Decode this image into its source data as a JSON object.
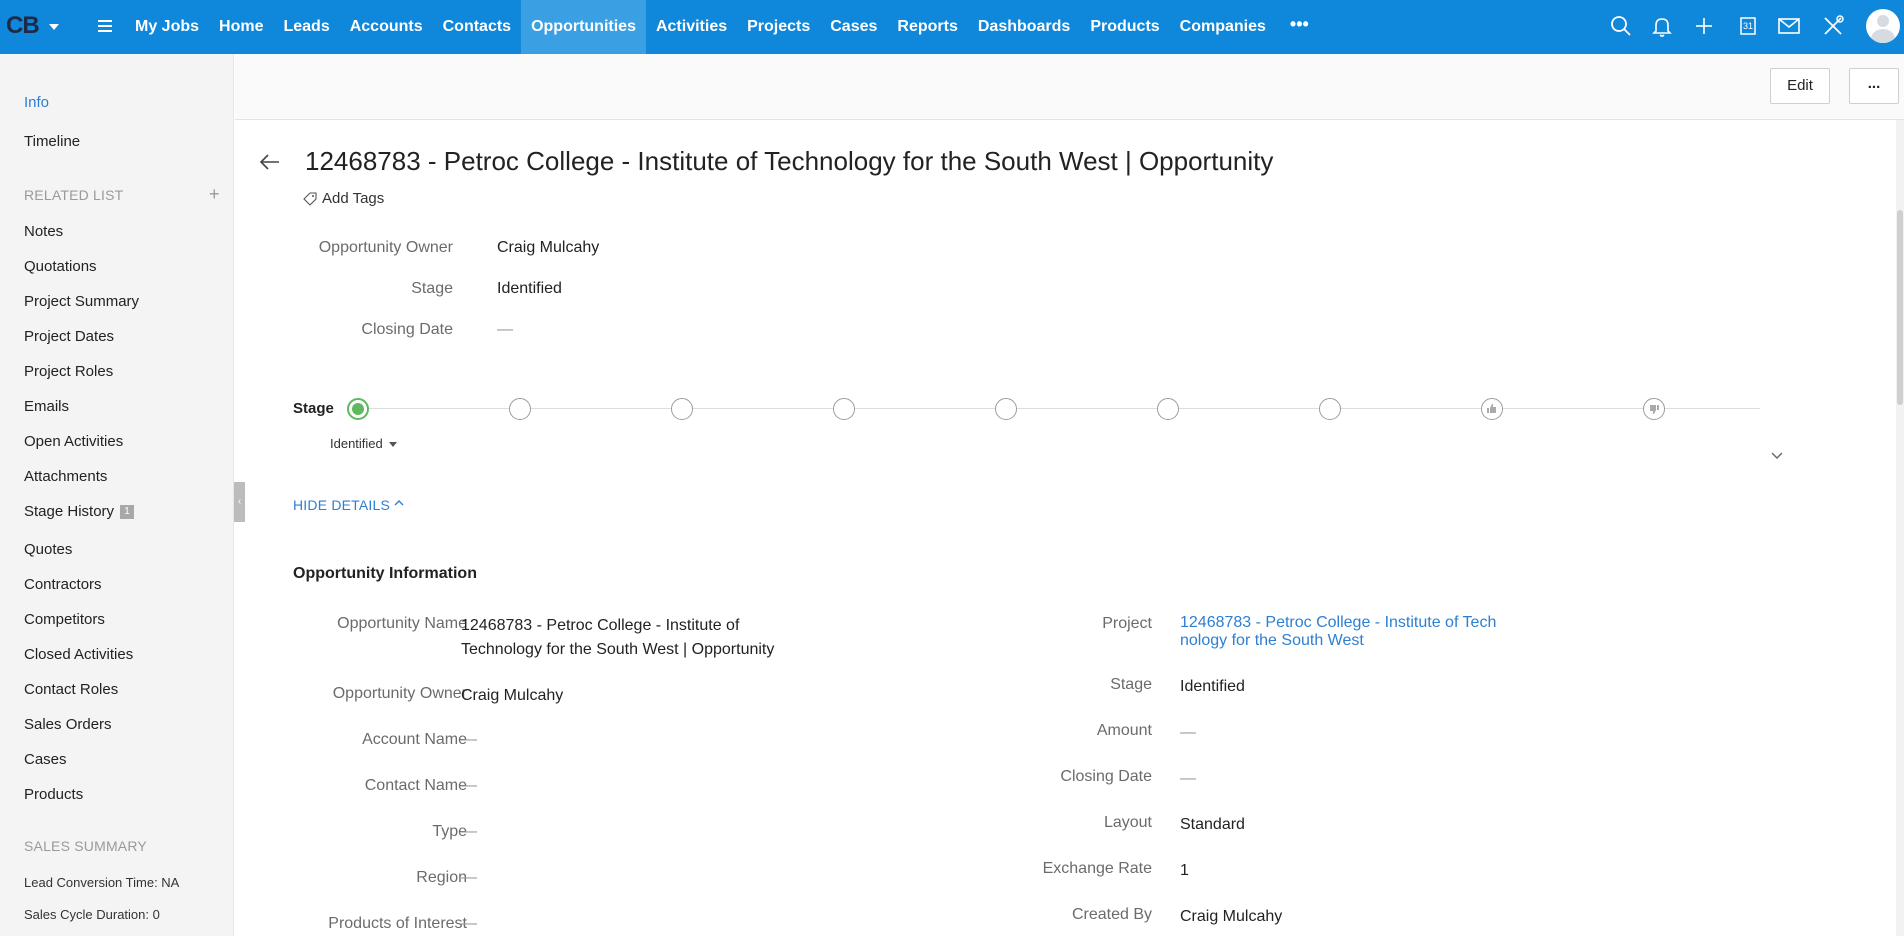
{
  "app": {
    "logo": "CB",
    "nav": [
      "My Jobs",
      "Home",
      "Leads",
      "Accounts",
      "Contacts",
      "Opportunities",
      "Activities",
      "Projects",
      "Cases",
      "Reports",
      "Dashboards",
      "Products",
      "Companies"
    ],
    "nav_active": "Opportunities",
    "nav_more": "•••",
    "icons": [
      "search-icon",
      "bell-icon",
      "plus-icon",
      "calendar-icon",
      "mail-icon",
      "tools-icon",
      "avatar"
    ],
    "calendar_day": "31",
    "accent": "#0f87da"
  },
  "sidebar": {
    "info": "Info",
    "timeline": "Timeline",
    "related_header": "RELATED LIST",
    "related": [
      "Notes",
      "Quotations",
      "Project Summary",
      "Project Dates",
      "Project Roles",
      "Emails",
      "Open Activities",
      "Attachments",
      "Stage History",
      "Quotes",
      "Contractors",
      "Competitors",
      "Closed Activities",
      "Contact Roles",
      "Sales Orders",
      "Cases",
      "Products"
    ],
    "stage_history_badge": "1",
    "sales_header": "SALES SUMMARY",
    "lead_conversion": "Lead Conversion Time: NA",
    "sales_cycle": "Sales Cycle Duration: 0"
  },
  "toolbar": {
    "edit": "Edit",
    "more": "..."
  },
  "record": {
    "title": "12468783 - Petroc College - Institute of Technology for the South West | Opportunity",
    "add_tags": "Add Tags",
    "summary": [
      {
        "label": "Opportunity Owner",
        "value": "Craig Mulcahy"
      },
      {
        "label": "Stage",
        "value": "Identified"
      },
      {
        "label": "Closing Date",
        "value": "—"
      }
    ]
  },
  "stage_bar": {
    "label": "Stage",
    "current": "Identified",
    "current_index": 0,
    "steps": 9,
    "success_color": "#5fb85f"
  },
  "details": {
    "toggle": "HIDE DETAILS",
    "section_title": "Opportunity Information",
    "left": [
      {
        "label": "Opportunity Name",
        "value": "12468783 - Petroc College - Institute of",
        "value2": "Technology for the South West | Opportunity"
      },
      {
        "label": "Opportunity Owner",
        "value": "Craig Mulcahy"
      },
      {
        "label": "Account Name",
        "value": "—"
      },
      {
        "label": "Contact Name",
        "value": "—"
      },
      {
        "label": "Type",
        "value": "—"
      },
      {
        "label": "Region",
        "value": "—"
      },
      {
        "label": "Products of Interest",
        "value": "—"
      }
    ],
    "right": [
      {
        "label": "Project",
        "value": "12468783 - Petroc College - Institute of Tech",
        "value2": "nology for the South West"
      },
      {
        "label": "Stage",
        "value": "Identified"
      },
      {
        "label": "Amount",
        "value": "—"
      },
      {
        "label": "Closing Date",
        "value": "—"
      },
      {
        "label": "Layout",
        "value": "Standard"
      },
      {
        "label": "Exchange Rate",
        "value": "1"
      },
      {
        "label": "Created By",
        "value": "Craig Mulcahy"
      }
    ]
  }
}
